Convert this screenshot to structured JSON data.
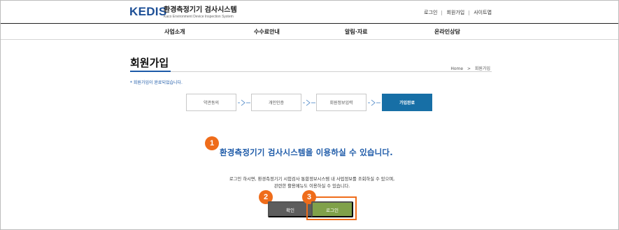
{
  "header": {
    "logo_mark": "KEDIS",
    "logo_name": "환경측정기기 검사시스템",
    "logo_sub": "Kaco Environment Device Inspection System",
    "util_links": [
      "로그인",
      "회원가입",
      "사이트맵"
    ]
  },
  "nav": {
    "items": [
      "사업소개",
      "수수료안내",
      "알림·자료",
      "온라인상담"
    ]
  },
  "page": {
    "title": "회원가입",
    "breadcrumb_home": "Home",
    "breadcrumb_sep": ">",
    "breadcrumb_current": "회원가입",
    "notice": "* 회원가입이 완료되었습니다."
  },
  "steps": [
    "약관동의",
    "개인인증",
    "회원정보입력",
    "가입완료"
  ],
  "active_step": 3,
  "callouts": [
    "1",
    "2",
    "3"
  ],
  "message": {
    "headline": "환경측정기기 검사시스템을 이용하실 수 있습니다.",
    "line1": "로그인 하시면, 환경측정기기 시험검사 통합정보시스템 내 사업정보를 조회하실 수 있으며,",
    "line2": "관련한 활용메뉴도 이용하실 수 있습니다."
  },
  "buttons": {
    "confirm": "확인",
    "login": "로그인"
  },
  "colors": {
    "brand_blue": "#1d5aa8",
    "active_step": "#176fa6",
    "callout_orange": "#ef6c1a",
    "login_green": "#80a14a",
    "confirm_gray": "#5d5d5d"
  }
}
